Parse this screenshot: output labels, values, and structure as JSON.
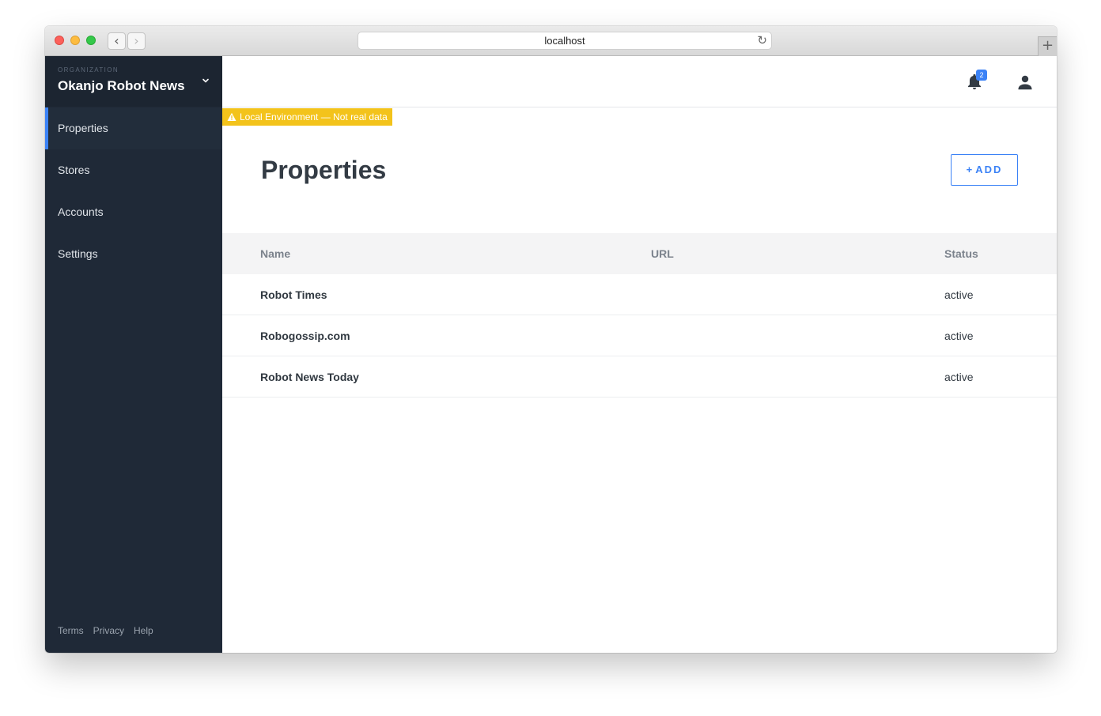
{
  "browser": {
    "url": "localhost",
    "back_glyph": "‹",
    "forward_glyph": "›",
    "reload_glyph": "↻",
    "newtab_glyph": "+"
  },
  "sidebar": {
    "org_caption": "ORGANIZATION",
    "org_name": "Okanjo Robot News",
    "items": [
      {
        "label": "Properties",
        "active": true
      },
      {
        "label": "Stores",
        "active": false
      },
      {
        "label": "Accounts",
        "active": false
      },
      {
        "label": "Settings",
        "active": false
      }
    ],
    "footer": [
      "Terms",
      "Privacy",
      "Help"
    ]
  },
  "header": {
    "notification_count": "2",
    "icons": [
      "bell-icon",
      "user-icon"
    ]
  },
  "env_banner": "Local Environment — Not real data",
  "page": {
    "title": "Properties",
    "add_plus": "+",
    "add_label": "ADD"
  },
  "table": {
    "columns": [
      "Name",
      "URL",
      "Status"
    ],
    "rows": [
      {
        "name": "Robot Times",
        "url": "",
        "status": "active"
      },
      {
        "name": "Robogossip.com",
        "url": "",
        "status": "active"
      },
      {
        "name": "Robot News Today",
        "url": "",
        "status": "active"
      }
    ]
  },
  "colors": {
    "sidebar_bg": "#1f2937",
    "accent": "#3b82f6",
    "banner": "#f3c31b"
  }
}
